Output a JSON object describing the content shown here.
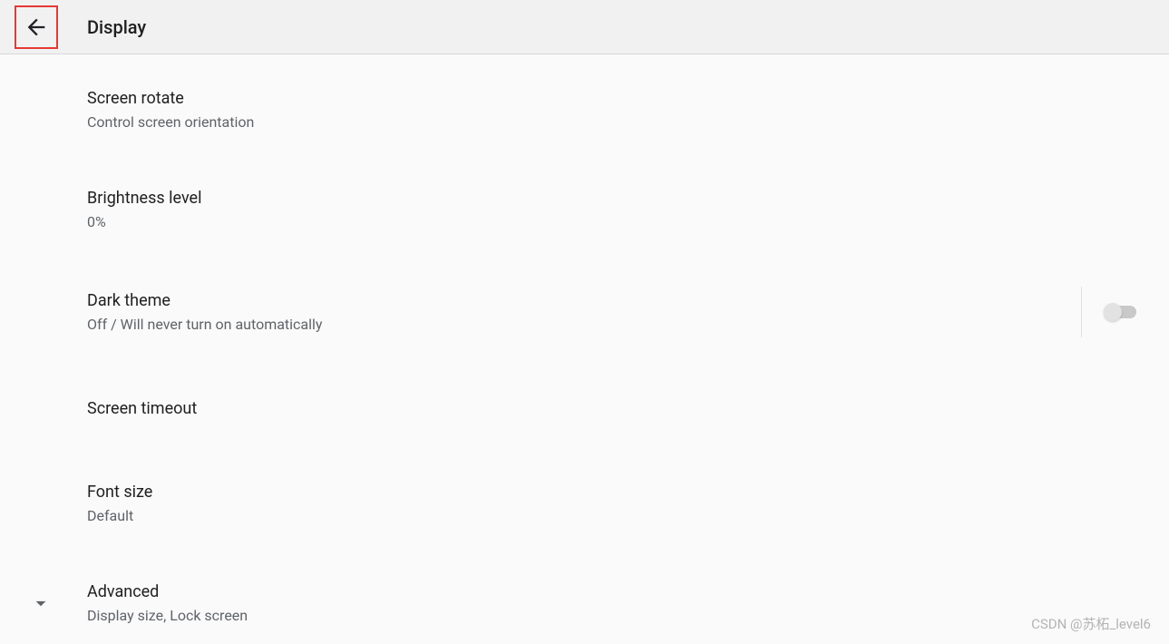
{
  "header": {
    "title": "Display"
  },
  "settings": {
    "screen_rotate": {
      "title": "Screen rotate",
      "subtitle": "Control screen orientation"
    },
    "brightness": {
      "title": "Brightness level",
      "subtitle": "0%"
    },
    "dark_theme": {
      "title": "Dark theme",
      "subtitle": "Off / Will never turn on automatically",
      "enabled": false
    },
    "screen_timeout": {
      "title": "Screen timeout",
      "subtitle": ""
    },
    "font_size": {
      "title": "Font size",
      "subtitle": "Default"
    },
    "advanced": {
      "title": "Advanced",
      "subtitle": "Display size, Lock screen"
    }
  },
  "watermark": "CSDN @苏柘_level6"
}
